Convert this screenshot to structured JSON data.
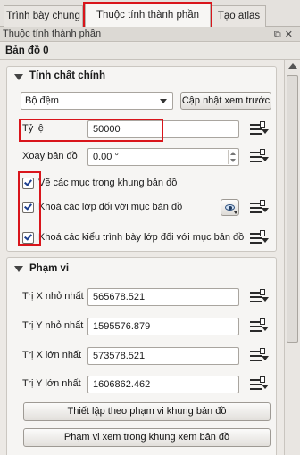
{
  "tabs": [
    "Trình bày chung",
    "Thuộc tính thành phần",
    "Tạo atlas"
  ],
  "active_tab": "Thuộc tính thành phần",
  "dock": {
    "title": "Thuộc tính thành phần",
    "float_icon": "float-icon",
    "close_icon": "close-icon"
  },
  "item": {
    "title": "Bản đồ 0"
  },
  "main_props": {
    "title": "Tính chất chính",
    "preview_mode": "Bộ đệm",
    "update_preview_button": "Cập nhật xem trước",
    "scale": {
      "label": "Tỷ lệ",
      "value": "50000"
    },
    "rotation": {
      "label": "Xoay bản đồ",
      "value": "0.00 °"
    },
    "checkboxes": [
      {
        "label": "Vẽ các mục trong khung bản đồ",
        "checked": true
      },
      {
        "label": "Khoá các lớp đối với mục bản đồ",
        "checked": true
      },
      {
        "label": "Khoá các kiểu trình bày lớp đối với mục bản đồ",
        "checked": true
      }
    ]
  },
  "extent": {
    "title": "Phạm vi",
    "fields": [
      {
        "label": "Trị X nhỏ nhất",
        "value": "565678.521"
      },
      {
        "label": "Trị Y nhỏ nhất",
        "value": "1595576.879"
      },
      {
        "label": "Trị X lớn nhất",
        "value": "573578.521"
      },
      {
        "label": "Trị Y lớn nhất",
        "value": "1606862.462"
      }
    ],
    "set_extent_button": "Thiết lập theo phạm vi khung bản đồ",
    "view_extent_button": "Phạm vi xem trong khung xem bản đồ"
  },
  "icons": {
    "data_defined": "data-defined-override-icon",
    "style_preset": "eye-icon"
  },
  "colors": {
    "highlight": "#d9151b"
  }
}
